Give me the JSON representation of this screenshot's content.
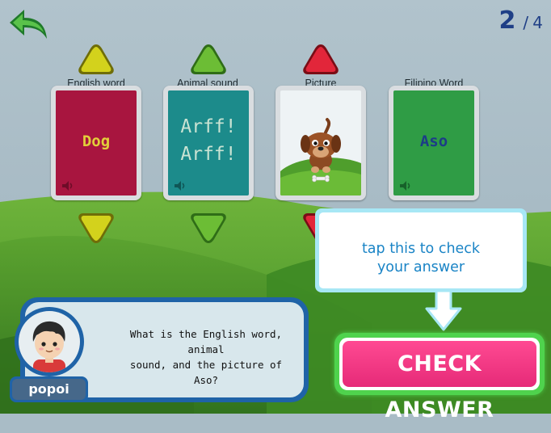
{
  "progress": {
    "current": "2",
    "separator": "/",
    "total": "4"
  },
  "colors": {
    "up_yellow": "#c9c716",
    "up_green": "#5fae2e",
    "up_red": "#d81d2c",
    "english_card": "#a8153f",
    "sound_card": "#1c8b8b",
    "filipino_card": "#2f9c45",
    "check_button": "#ff3d8b",
    "tip_text": "#1a84c6"
  },
  "cards": [
    {
      "label": "English word",
      "text": "Dog",
      "arrow_color": "yellow"
    },
    {
      "label": "Animal sound",
      "line1": "Arff!",
      "line2": "Arff!",
      "arrow_color": "green"
    },
    {
      "label": "Picture",
      "image": "dog-picture",
      "arrow_color": "red"
    },
    {
      "label": "Filipino Word",
      "text": "Aso"
    }
  ],
  "tooltip": {
    "line1": "tap this to check",
    "line2": "your answer"
  },
  "dialog": {
    "line1": "What is the English word, animal",
    "line2": "sound, and the picture of",
    "line3": "Aso?"
  },
  "character": {
    "name": "popoi"
  },
  "check_button": {
    "label": "CHECK ANSWER"
  },
  "icons": [
    "back-arrow-icon",
    "speaker-icon",
    "triangle-up-icon",
    "triangle-down-icon",
    "down-arrow-hint-icon"
  ]
}
